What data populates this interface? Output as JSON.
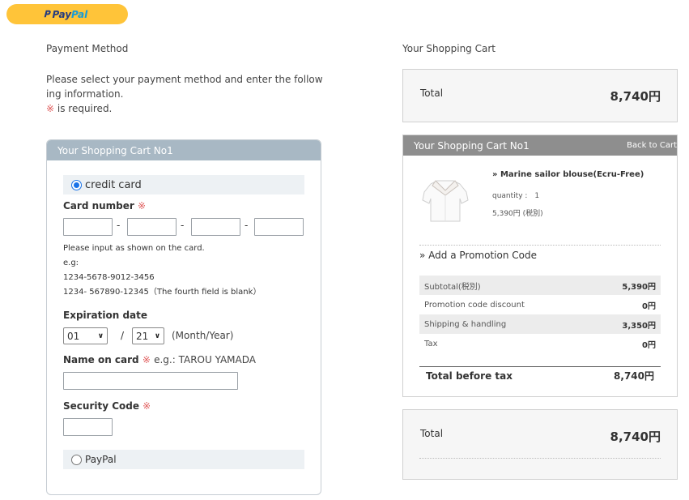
{
  "paypal_button": {
    "part1": "Pay",
    "part2": "Pal"
  },
  "payment_method": {
    "title": "Payment Method",
    "instructions": "Please select your payment method and enter the following information.",
    "required_mark": "※",
    "required_text": " is required."
  },
  "left_panel": {
    "header": "Your Shopping Cart No1",
    "credit_card_label": "credit card",
    "card_number_label": "Card number",
    "required_mark": "※",
    "card_note_1": "Please input as shown on the card.",
    "card_note_2": "e.g:",
    "card_note_3": "1234-5678-9012-3456",
    "card_note_4": "1234- 567890-12345（The fourth field is blank）",
    "expiration_label": "Expiration date",
    "month_value": "01",
    "year_value": "21",
    "date_separator": "/",
    "month_year_hint": "(Month/Year)",
    "name_label": "Name on card",
    "name_example": "e.g.: TAROU YAMADA",
    "security_label": "Security Code",
    "paypal_label": "PayPal",
    "card_dash": "-"
  },
  "right": {
    "cart_title": "Your Shopping Cart",
    "total_label": "Total",
    "total_value": "8,740円",
    "cart_header": "Your Shopping Cart No1",
    "back_to_cart": "Back to Cart",
    "item_name": "» Marine sailor blouse(Ecru-Free)",
    "item_quantity": "quantity :　1",
    "item_price": "5,390円 (税別)",
    "promo_label": "» Add a Promotion Code",
    "summary": [
      {
        "label": "Subtotal(税別)",
        "value": "5,390円"
      },
      {
        "label": "Promotion code discount",
        "value": "0円"
      },
      {
        "label": "Shipping & handling",
        "value": "3,350円"
      },
      {
        "label": "Tax",
        "value": "0円"
      }
    ],
    "before_tax_label": "Total before tax",
    "before_tax_value": "8,740円"
  }
}
